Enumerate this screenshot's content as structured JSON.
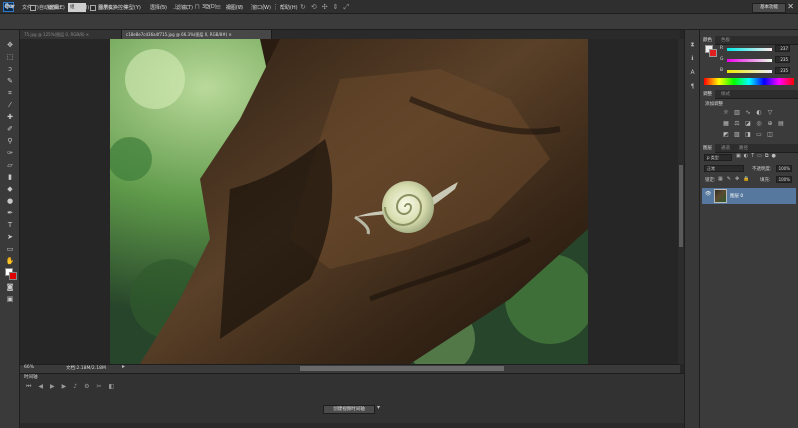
{
  "app": {
    "logo": "Ps"
  },
  "menu": [
    "文件(F)",
    "编辑(E)",
    "图像(I)",
    "图层(L)",
    "类型(Y)",
    "选择(S)",
    "滤镜(T)",
    "3D(D)",
    "视图(V)",
    "窗口(W)",
    "帮助(H)"
  ],
  "window_controls": [
    "—",
    "□",
    "✕"
  ],
  "options": {
    "autoselect_label": "自动选择:",
    "autoselect_value": "组",
    "transform_label": "显示变换控件",
    "workspace": "基本功能"
  },
  "tabs": [
    "75.jpg @ 125%(图层 0, RGB/8)",
    "c18e8e7cd36a4f715.jpg @ 66.3%(图层 0, RGB/8#)"
  ],
  "color_panel": {
    "tabs": [
      "颜色",
      "色板"
    ],
    "channels": [
      {
        "label": "R",
        "value": "237"
      },
      {
        "label": "G",
        "value": "235"
      },
      {
        "label": "B",
        "value": "235"
      }
    ]
  },
  "adjustments": {
    "tabs": [
      "调整",
      "样式"
    ],
    "title": "添加调整"
  },
  "layers": {
    "tabs": [
      "图层",
      "通道",
      "路径"
    ],
    "filter": "p 类型",
    "blend_mode": "正常",
    "opacity_label": "不透明度:",
    "opacity_value": "100%",
    "lock_label": "锁定:",
    "fill_label": "填充:",
    "fill_value": "100%",
    "layer_name": "图层 0"
  },
  "status": {
    "zoom": "66%",
    "doc_info": "文档:2.18M/2.18M"
  },
  "timeline": {
    "title": "时间轴",
    "create_button": "创建视频时间轴"
  },
  "colors": {
    "accent": "#56789e",
    "background_swatch": "#e00000"
  }
}
